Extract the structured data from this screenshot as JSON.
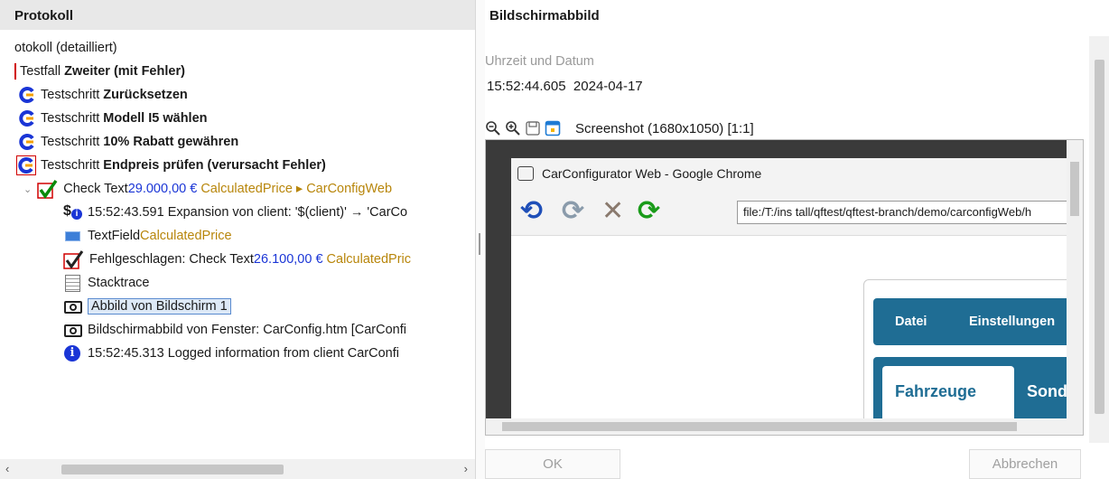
{
  "left_panel": {
    "title": "Protokoll",
    "tree": {
      "root": "otokoll (detailliert)",
      "testcase_prefix": "Testfall ",
      "testcase_name": "Zweiter (mit Fehler)",
      "steps": [
        {
          "prefix": "Testschritt ",
          "name": "Zurücksetzen"
        },
        {
          "prefix": "Testschritt ",
          "name": "Modell I5 wählen"
        },
        {
          "prefix": "Testschritt ",
          "name": "10% Rabatt gewähren"
        },
        {
          "prefix": "Testschritt ",
          "name": "Endpreis prüfen (verursacht Fehler)"
        }
      ],
      "check": {
        "prefix": "Check Text ",
        "value": "29.000,00 €",
        "component": "CalculatedPrice ▸ CarConfigWeb"
      },
      "children": {
        "expansion": "15:52:43.591 Expansion von client: '$(client)' → 'CarCo",
        "textfield_prefix": "TextField ",
        "textfield_name": "CalculatedPrice",
        "failed_prefix": "Fehlgeschlagen: Check Text ",
        "failed_value": "26.100,00 €",
        "failed_component": "CalculatedPric",
        "stacktrace": "Stacktrace",
        "screenshot1": "Abbild von Bildschirm 1",
        "window_shot": "Bildschirmabbild von Fenster: CarConfig.htm [CarConfi",
        "info": "15:52:45.313 Logged information from client CarConfi"
      }
    }
  },
  "right_panel": {
    "title": "Bildschirmabbild",
    "time_label": "Uhrzeit und Datum",
    "time_value": "15:52:44.605  2024-04-17",
    "screenshot_label": "Screenshot (1680x1050) [1:1]",
    "browser": {
      "title": "CarConfigurator Web - Google Chrome",
      "url": "file:/T:/ins tall/qftest/qftest-branch/demo/carconfigWeb/h",
      "menu": [
        "Datei",
        "Einstellungen"
      ],
      "tabs": [
        "Fahrzeuge",
        "Sonde"
      ]
    },
    "buttons": {
      "ok": "OK",
      "cancel": "Abbrechen"
    }
  },
  "colors": {
    "accent_blue": "#1a35d6",
    "component_gold": "#b8860b",
    "app_blue": "#1f6d94",
    "error_red": "#d10000"
  }
}
